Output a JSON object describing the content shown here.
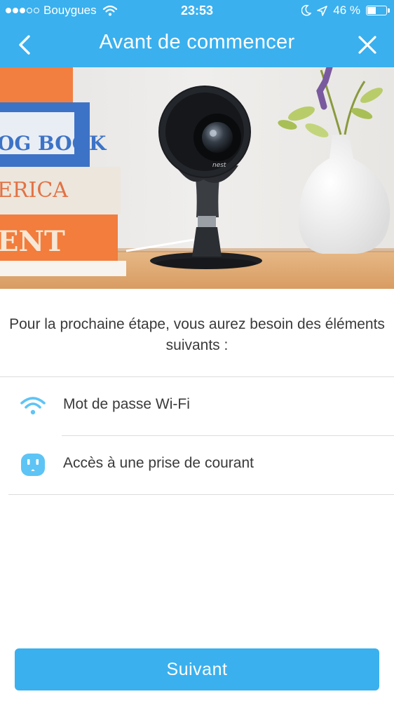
{
  "status_bar": {
    "carrier": "Bouygues",
    "time": "23:53",
    "battery_text": "46 %",
    "battery_level": 0.46,
    "signal_bars_filled": 3,
    "signal_bars_total": 5
  },
  "nav": {
    "title": "Avant de commencer",
    "back_icon": "chevron-left-icon",
    "close_icon": "close-icon"
  },
  "hero": {
    "book_text_1": "OG BOOK",
    "book_text_2": "ERICA",
    "book_text_3": "ENT",
    "camera_brand": "nest"
  },
  "intro": "Pour la prochaine étape, vous aurez besoin des éléments suivants :",
  "requirements": [
    {
      "icon": "wifi-icon",
      "label": "Mot de passe Wi-Fi"
    },
    {
      "icon": "power-outlet-icon",
      "label": "Accès à une prise de courant"
    }
  ],
  "next_button": "Suivant",
  "colors": {
    "accent": "#3ab0ee",
    "text": "#3a3a3a",
    "divider": "#dcdcdc",
    "icon": "#5ec4f5"
  }
}
